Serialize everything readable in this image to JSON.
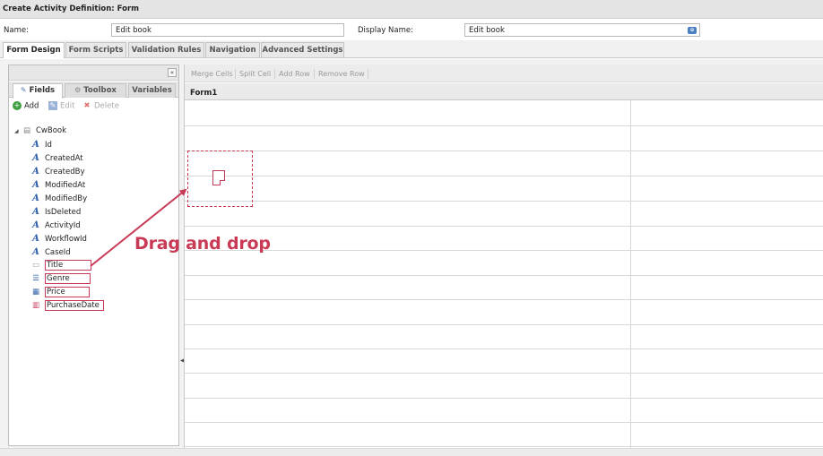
{
  "window": {
    "title": "Create Activity Definition: Form"
  },
  "form_header": {
    "name_label": "Name:",
    "name_value": "Edit book",
    "display_label": "Display Name:",
    "display_value": "Edit book"
  },
  "main_tabs": [
    {
      "label": "Form Design",
      "active": true
    },
    {
      "label": "Form Scripts",
      "active": false
    },
    {
      "label": "Validation Rules",
      "active": false
    },
    {
      "label": "Navigation",
      "active": false
    },
    {
      "label": "Advanced Settings",
      "active": false
    }
  ],
  "left_panel": {
    "collapse_icon": "double-chevron-left-icon",
    "tabs": [
      {
        "label": "Fields",
        "icon": "pencil-icon",
        "active": true
      },
      {
        "label": "Toolbox",
        "icon": "gear-icon",
        "active": false
      },
      {
        "label": "Variables",
        "icon": "",
        "active": false
      }
    ],
    "toolbar": [
      {
        "label": "Add",
        "icon": "add-icon",
        "enabled": true
      },
      {
        "label": "Edit",
        "icon": "edit-icon",
        "enabled": false
      },
      {
        "label": "Delete",
        "icon": "delete-icon",
        "enabled": false
      }
    ],
    "tree": {
      "root": "CwBook",
      "fields": [
        {
          "label": "Id",
          "icon": "text-field-icon"
        },
        {
          "label": "CreatedAt",
          "icon": "text-field-icon"
        },
        {
          "label": "CreatedBy",
          "icon": "text-field-icon"
        },
        {
          "label": "ModifiedAt",
          "icon": "text-field-icon"
        },
        {
          "label": "ModifiedBy",
          "icon": "text-field-icon"
        },
        {
          "label": "IsDeleted",
          "icon": "text-field-icon"
        },
        {
          "label": "ActivityId",
          "icon": "text-field-icon"
        },
        {
          "label": "WorkflowId",
          "icon": "text-field-icon"
        },
        {
          "label": "CaseId",
          "icon": "text-field-icon"
        },
        {
          "label": "Title",
          "icon": "textbox-icon",
          "highlighted": true
        },
        {
          "label": "Genre",
          "icon": "dropdown-icon",
          "highlighted": true
        },
        {
          "label": "Price",
          "icon": "number-icon",
          "highlighted": true
        },
        {
          "label": "PurchaseDate",
          "icon": "calendar-icon",
          "highlighted": true
        }
      ]
    }
  },
  "designer": {
    "toolbar": [
      "Merge Cells",
      "Split Cell",
      "Add Row",
      "Remove Row"
    ],
    "form_title": "Form1"
  },
  "annotation": {
    "label": "Drag and drop",
    "color": "#c83a55"
  },
  "colors": {
    "accent": "#c83a55",
    "field_icon": "#2e5fa8"
  }
}
